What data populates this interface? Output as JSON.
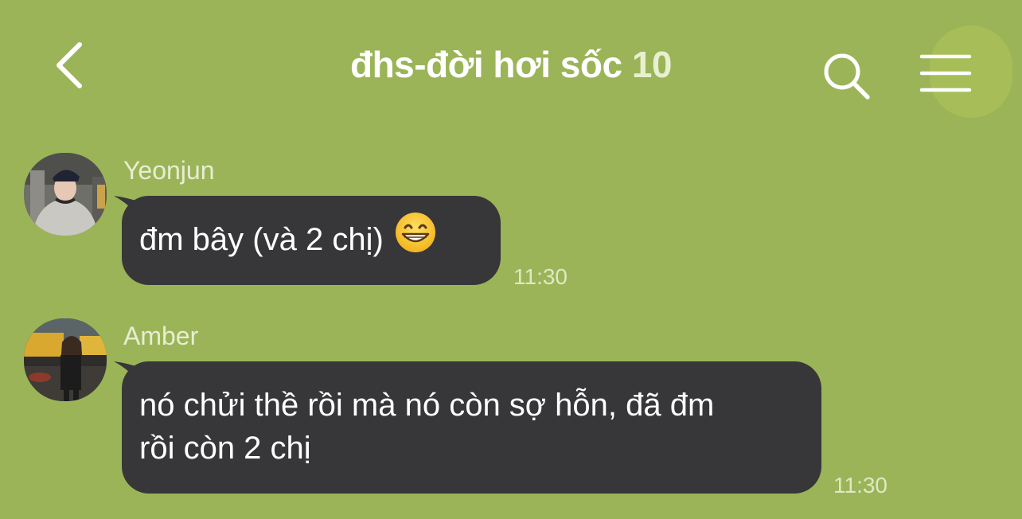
{
  "header": {
    "title": "đhs-đời hơi sốc",
    "member_count": "10",
    "back_icon": "chevron-left-icon",
    "search_icon": "search-icon",
    "menu_icon": "hamburger-menu-icon"
  },
  "colors": {
    "background": "#9bb458",
    "bubble": "#373739",
    "bubble_text": "#ffffff",
    "sender_name": "#e7eed2",
    "timestamp": "#dfe8c4"
  },
  "messages": [
    {
      "sender": "Yeonjun",
      "text": "đm bây (và 2 chị)",
      "emoji": "grinning-face-emoji",
      "time": "11:30"
    },
    {
      "sender": "Amber",
      "text_line1": "nó chửi thề rồi mà nó còn sợ hỗn, đã đm",
      "text_line2": "rồi còn 2 chị",
      "time": "11:30"
    }
  ]
}
